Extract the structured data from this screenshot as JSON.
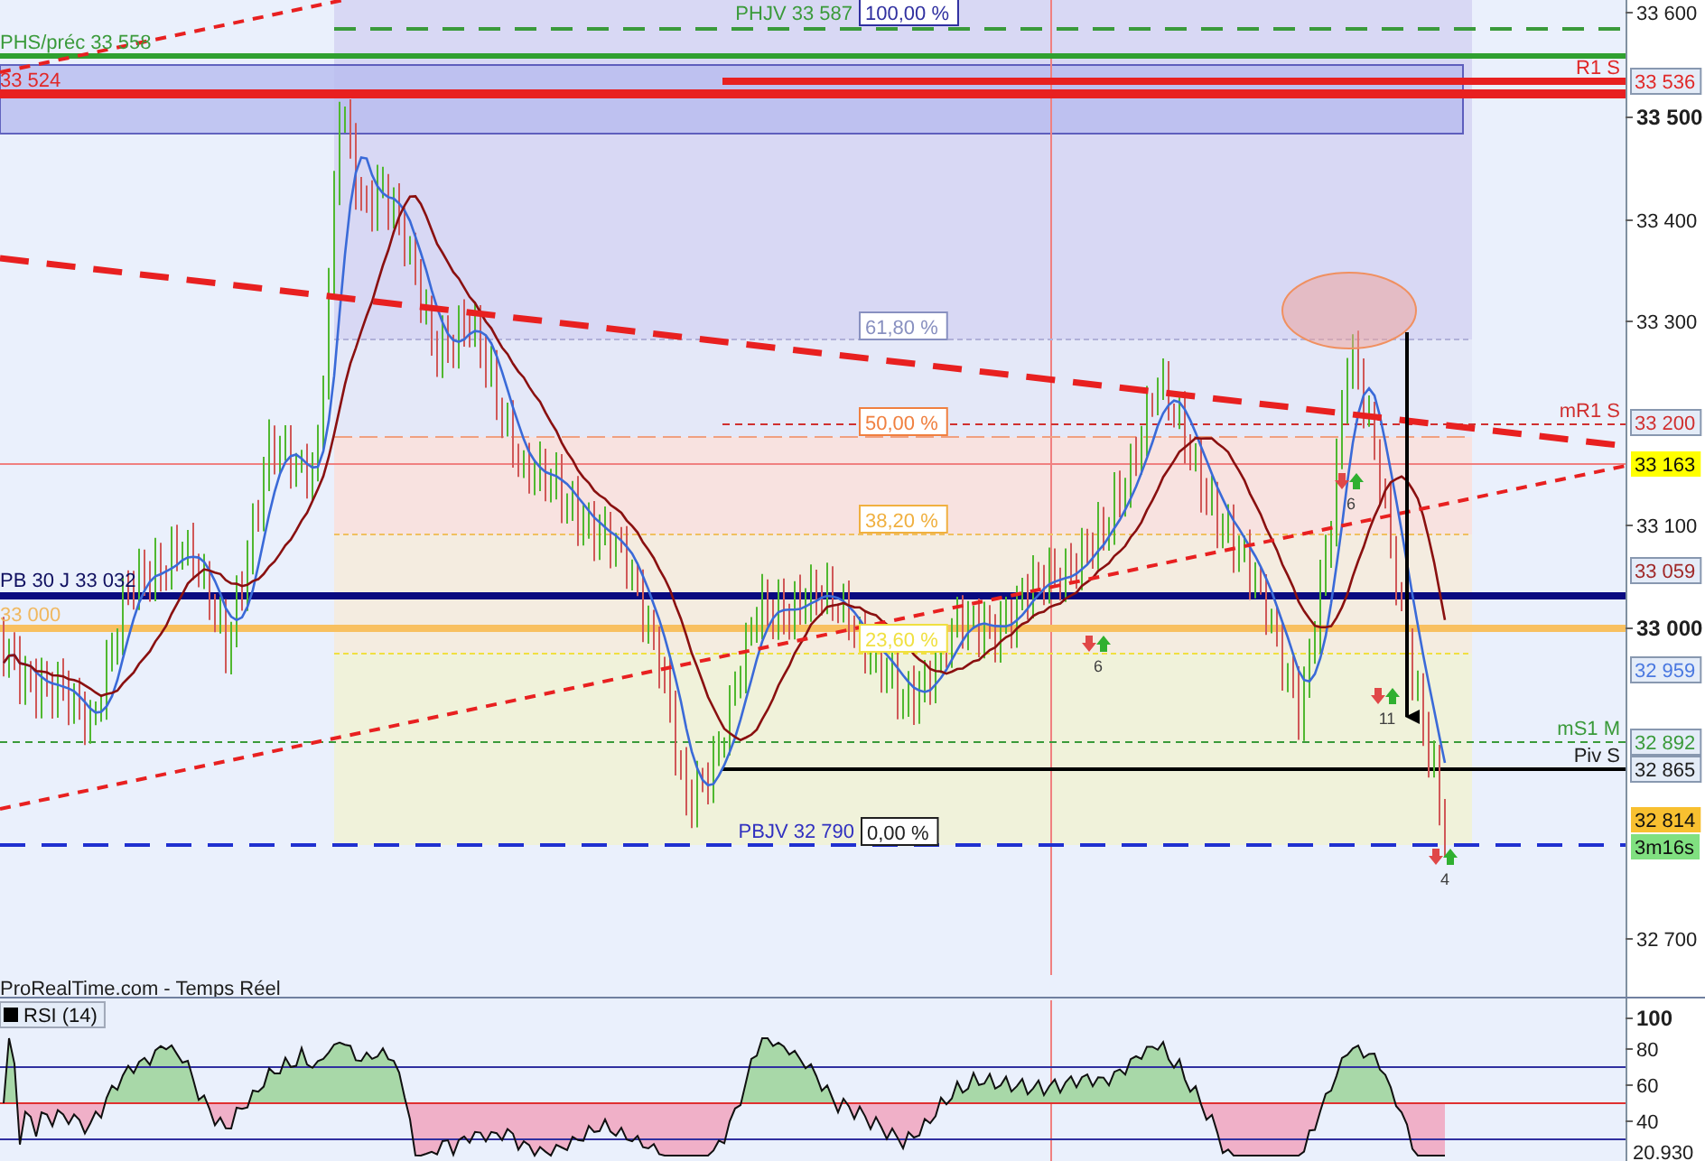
{
  "price_axis_ticks": [
    {
      "label": "33 600",
      "major": false
    },
    {
      "label": "33 500",
      "major": true
    },
    {
      "label": "33 400",
      "major": false
    },
    {
      "label": "33 300",
      "major": false
    },
    {
      "label": "33 100",
      "major": false
    },
    {
      "label": "33 000",
      "major": true
    },
    {
      "label": "32 700",
      "major": false
    }
  ],
  "price_tags": [
    {
      "label": "33 536",
      "kind": "outline",
      "color": "#e02828"
    },
    {
      "label": "33 200",
      "kind": "outline",
      "color": "#d03030"
    },
    {
      "label": "33 163",
      "kind": "filled",
      "color": "#ffff00"
    },
    {
      "label": "33 059",
      "kind": "outline",
      "color": "#a02828"
    },
    {
      "label": "32 959",
      "kind": "outline",
      "color": "#4a78e0"
    },
    {
      "label": "32 892",
      "kind": "outline",
      "color": "#3a9a3a"
    },
    {
      "label": "32 865",
      "kind": "outline",
      "color": "#202020"
    },
    {
      "label": "32 814",
      "kind": "filled",
      "color": "#f8c030"
    },
    {
      "label": "3m16s",
      "kind": "filled",
      "color": "#80e080"
    }
  ],
  "level_labels": [
    {
      "label": "PHJV 33 587",
      "color": "#3a9a3a"
    },
    {
      "label": "PHS/préc 33 558",
      "color": "#3a9a3a"
    },
    {
      "label": "33 524",
      "color": "#e02828"
    },
    {
      "label": "R1 S",
      "color": "#e02828"
    },
    {
      "label": "mR1 S",
      "color": "#d03030"
    },
    {
      "label": "PB 30 J 33 032",
      "color": "#101060"
    },
    {
      "label": "33 000",
      "color": "#f0b860"
    },
    {
      "label": "mS1 M",
      "color": "#3a9a3a"
    },
    {
      "label": "Piv S",
      "color": "#202020"
    },
    {
      "label": "PBJV 32 790",
      "color": "#3030c0"
    }
  ],
  "fib_labels": [
    {
      "label": "100,00 %",
      "color": "#3030a0"
    },
    {
      "label": "61,80 %",
      "color": "#8890c0"
    },
    {
      "label": "50,00 %",
      "color": "#f08040"
    },
    {
      "label": "38,20 %",
      "color": "#f0b040"
    },
    {
      "label": "23,60 %",
      "color": "#f0e040"
    },
    {
      "label": "0,00 %",
      "color": "#202020"
    }
  ],
  "signals": [
    {
      "count": "6"
    },
    {
      "count": "6"
    },
    {
      "count": "11"
    },
    {
      "count": "4"
    }
  ],
  "source_note": "ProRealTime.com - Temps Réel",
  "rsi": {
    "legend": "RSI (14)",
    "ticks": [
      "100",
      "80",
      "60",
      "40"
    ],
    "reading": "20.930"
  }
}
